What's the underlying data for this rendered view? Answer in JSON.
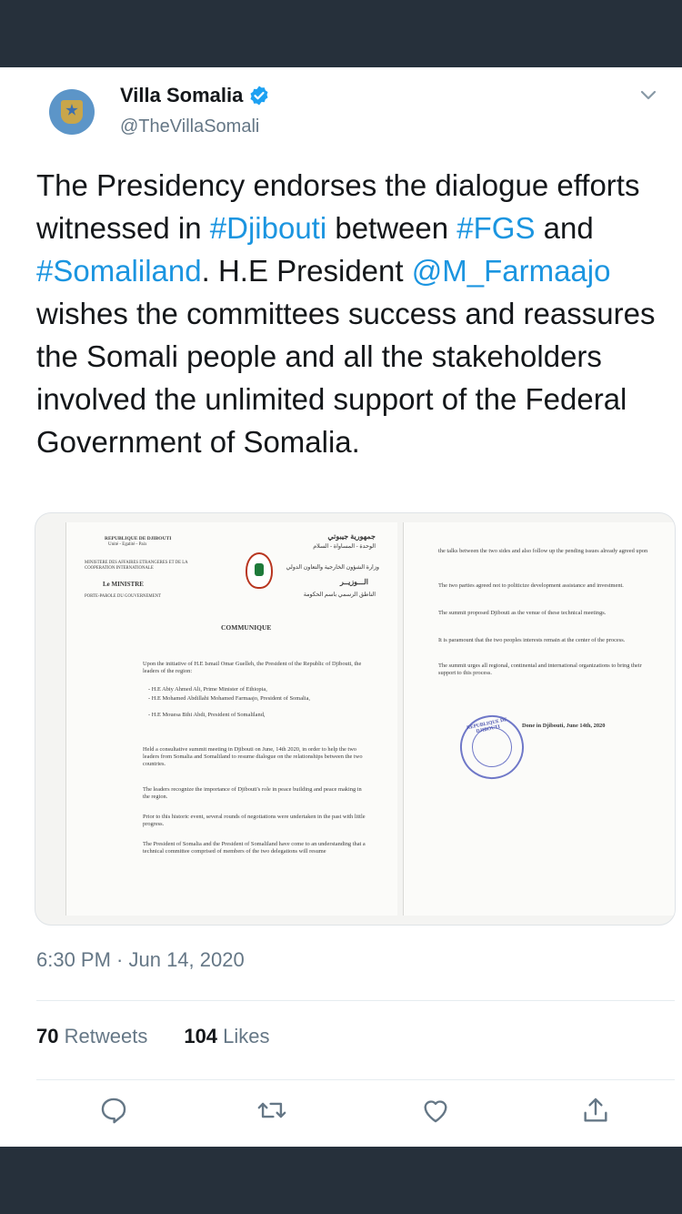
{
  "account": {
    "name": "Villa Somalia",
    "handle": "@TheVillaSomali"
  },
  "tweet": {
    "parts": [
      {
        "text": "The Presidency endorses the dialogue efforts witnessed in ",
        "link": false
      },
      {
        "text": "#Djibouti",
        "link": true
      },
      {
        "text": " between ",
        "link": false
      },
      {
        "text": "#FGS",
        "link": true
      },
      {
        "text": " and ",
        "link": false
      },
      {
        "text": "#Somaliland",
        "link": true
      },
      {
        "text": ". H.E President ",
        "link": false
      },
      {
        "text": "@M_Farmaajo",
        "link": true
      },
      {
        "text": " wishes the committees success and reassures the Somali people and all the stakeholders involved the unlimited support of the Federal Government of Somalia.",
        "link": false
      }
    ],
    "timestamp": "6:30 PM · Jun 14, 2020"
  },
  "stats": {
    "retweets_count": "70",
    "retweets_label": "Retweets",
    "likes_count": "104",
    "likes_label": "Likes"
  },
  "document": {
    "header_left_1": "REPUBLIQUE DE DJIBOUTI",
    "header_left_2": "Unité - Egalité - Paix",
    "header_left_3": "MINISTERE DES AFFAIRES ETRANGERES ET DE LA COOPERATION INTERNATIONALE",
    "minister": "Le MINISTRE",
    "porte_parole": "PORTE-PAROLE DU GOUVERNEMENT",
    "header_right_1": "جمهورية جيبوتي",
    "header_right_2": "الوحدة - المساواة - السلام",
    "header_right_3": "وزارة الشؤون الخارجية والتعاون الدولي",
    "header_right_4": "الـــوزيــر",
    "header_right_5": "الناطق الرسمي باسم الحكومة",
    "title": "COMMUNIQUE",
    "p1": "Upon the initiative of H.E Ismail Omar Guelleh, the President of the Republic of Djibouti, the leaders of the region:",
    "b1": "- H.E Abiy Ahmed Ali, Prime Minister of Ethiopia,",
    "b2": "- H.E Mohamed Abdillahi Mohamed Farmaajo, President of Somalia,",
    "b3": "- H.E Mouesa Bihi Abdi, President of Somaliland,",
    "p2": "Held a consultative summit meeting in Djibouti on June, 14th 2020, in order to help the two leaders from Somalia and Somaliland to resume dialogue on the relationships between the two countries.",
    "p3": "The leaders recognize the importance of Djibouti's role in peace building and peace making in the region.",
    "p4": "Prior to this historic event, several rounds of negotiations were undertaken in the past with little progress.",
    "p5": "The President of Somalia and the President of Somaliland have come to an understanding that a technical committee comprised of members of the two delegations will resume",
    "r1": "the talks between the two sides and also follow up the pending issues already agreed upon",
    "r2": "The two parties agreed not to politicize development assistance and investment.",
    "r3": "The summit proposed Djibouti as the venue of these technical meetings.",
    "r4": "It is paramount that the two peoples interests remain at the center of the process.",
    "r5": "The summit urges all regional, continental and international organizations to bring their support to this process.",
    "done": "Done in Djibouti, June 14th, 2020",
    "stamp": "REPUBLIQUE DE DJIBOUTI"
  },
  "colors": {
    "link": "#1b95e0",
    "text": "#14171a",
    "muted": "#657786",
    "chrome": "#26303b"
  },
  "icons": [
    "verified-badge-icon",
    "chevron-down-icon",
    "reply-icon",
    "retweet-icon",
    "like-icon",
    "share-icon"
  ]
}
